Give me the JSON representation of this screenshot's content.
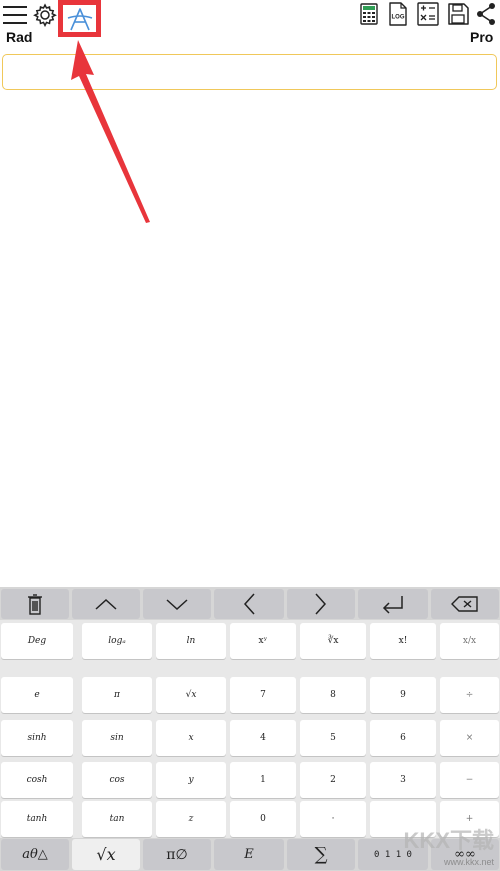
{
  "toolbar": {
    "angle_mode": "Rad",
    "pro_label": "Pro",
    "icons": [
      "menu-icon",
      "gear-icon",
      "font-icon",
      "calculator-icon",
      "log-icon",
      "math-sheet-icon",
      "save-icon",
      "share-icon"
    ],
    "log_icon_text": "LOG"
  },
  "input": {
    "value": ""
  },
  "annotation": {
    "color": "#e8353b"
  },
  "keyboard": {
    "nav_keys": [
      "trash-icon",
      "up-arrow-icon",
      "down-arrow-icon",
      "left-arrow-icon",
      "right-arrow-icon",
      "enter-icon",
      "backspace-icon"
    ],
    "rows": [
      [
        "Deg",
        "logₐ",
        "ln",
        "xʸ",
        "∛x",
        "x!",
        "x/x"
      ],
      [
        "e",
        "π",
        "√x",
        "7",
        "8",
        "9",
        "÷"
      ],
      [
        "sinh",
        "sin",
        "x",
        "4",
        "5",
        "6",
        "×"
      ],
      [
        "cosh",
        "cos",
        "y",
        "1",
        "2",
        "3",
        "−"
      ],
      [
        "tanh",
        "tan",
        "z",
        "0",
        "·",
        "",
        "+"
      ]
    ],
    "bottom": {
      "b1": "aθ△",
      "b2": "√x",
      "b3": "π∅",
      "b4": "E",
      "b5": "∑",
      "b6": "0 1 1 0",
      "b7": "∞∞"
    },
    "watermark_big": "KKX下载",
    "watermark_small": "www.kkx.net"
  }
}
